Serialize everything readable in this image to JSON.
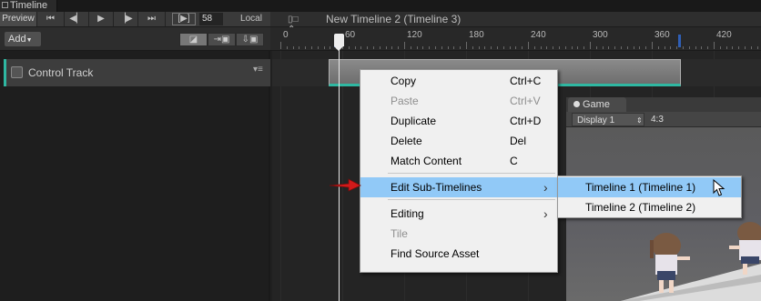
{
  "window": {
    "tab_title": "Timeline"
  },
  "transport": {
    "preview_label": "Preview",
    "frame_value": "58",
    "local_label": "Local",
    "buttons": [
      "first-frame",
      "previous-frame",
      "play",
      "next-frame",
      "last-frame",
      "frame-range"
    ]
  },
  "header": {
    "sequence_label": "New Timeline 2 (Timeline 3)"
  },
  "toolbar": {
    "add_label": "Add"
  },
  "ruler": {
    "ticks": [
      "0",
      "60",
      "120",
      "180",
      "240",
      "300",
      "360",
      "420"
    ]
  },
  "track": {
    "name": "Control Track",
    "accent_color": "#2fb8a2"
  },
  "context_menu": {
    "items": [
      {
        "label": "Copy",
        "shortcut": "Ctrl+C",
        "enabled": true
      },
      {
        "label": "Paste",
        "shortcut": "Ctrl+V",
        "enabled": false
      },
      {
        "label": "Duplicate",
        "shortcut": "Ctrl+D",
        "enabled": true
      },
      {
        "label": "Delete",
        "shortcut": "Del",
        "enabled": true
      },
      {
        "label": "Match Content",
        "shortcut": "C",
        "enabled": true
      },
      {
        "label": "Edit Sub-Timelines",
        "shortcut": "",
        "enabled": true,
        "highlighted": true
      },
      {
        "label": "Editing",
        "shortcut": "",
        "enabled": true
      },
      {
        "label": "Tile",
        "shortcut": "",
        "enabled": false
      },
      {
        "label": "Find Source Asset",
        "shortcut": "",
        "enabled": true
      }
    ],
    "highlight_color": "#91c9f7"
  },
  "submenu": {
    "items": [
      {
        "label": "Timeline 1 (Timeline 1)",
        "highlighted": true
      },
      {
        "label": "Timeline 2 (Timeline 2)",
        "highlighted": false
      }
    ]
  },
  "game_view": {
    "tab_label": "Game",
    "display_label": "Display 1",
    "aspect_label": "4:3"
  },
  "annotation": {
    "arrow_color": "#d11a1a"
  }
}
